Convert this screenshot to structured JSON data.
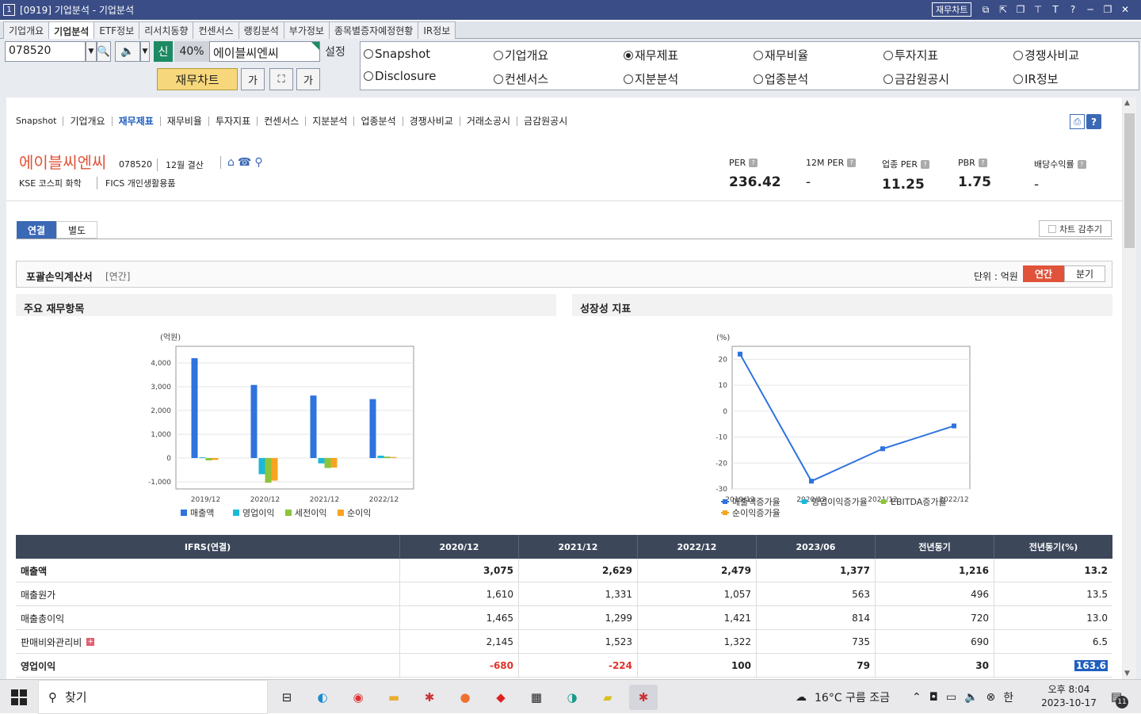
{
  "window": {
    "num": "1",
    "title": "[0919] 기업분석 - 기업분석",
    "fin_chart_btn": "재무차트",
    "icons": [
      "copy-icon",
      "pin-icon",
      "restore-icon",
      "pin2-icon",
      "font-icon",
      "help-icon",
      "minimize-icon",
      "maximize-icon",
      "close-icon"
    ]
  },
  "top_tabs": [
    "기업개요",
    "기업분석",
    "ETF정보",
    "리서치동향",
    "컨센서스",
    "랭킹분석",
    "부가정보",
    "종목별증자예정현황",
    "IR정보"
  ],
  "toolbar": {
    "code": "078520",
    "new_label": "신",
    "percent": "40%",
    "name": "에이블씨엔씨",
    "settings": "설정",
    "fin_chart": "재무차트"
  },
  "radios": [
    {
      "label": "Snapshot",
      "on": false
    },
    {
      "label": "기업개요",
      "on": false
    },
    {
      "label": "재무제표",
      "on": true
    },
    {
      "label": "재무비율",
      "on": false
    },
    {
      "label": "투자지표",
      "on": false
    },
    {
      "label": "경쟁사비교",
      "on": false
    },
    {
      "label": "Disclosure",
      "on": false
    },
    {
      "label": "컨센서스",
      "on": false
    },
    {
      "label": "지분분석",
      "on": false
    },
    {
      "label": "업종분석",
      "on": false
    },
    {
      "label": "금감원공시",
      "on": false
    },
    {
      "label": "IR정보",
      "on": false
    }
  ],
  "subnav": [
    "Snapshot",
    "기업개요",
    "재무제표",
    "재무비율",
    "투자지표",
    "컨센서스",
    "지분분석",
    "업종분석",
    "경쟁사비교",
    "거래소공시",
    "금감원공시"
  ],
  "company": {
    "name": "에이블씨엔씨",
    "code": "078520",
    "settle": "12월 결산",
    "market": "KSE  코스피 화학",
    "fics": "FICS 개인생활용품"
  },
  "metrics": [
    {
      "label": "PER",
      "value": "236.42"
    },
    {
      "label": "12M PER",
      "value": "-"
    },
    {
      "label": "업종 PER",
      "value": "11.25"
    },
    {
      "label": "PBR",
      "value": "1.75"
    },
    {
      "label": "배당수익률",
      "value": "-"
    }
  ],
  "consol_tabs": [
    "연결",
    "별도"
  ],
  "chart_collapse": "차트 감추기",
  "section": {
    "title": "포괄손익계산서",
    "sub": "[연간]",
    "unit": "단위 : 억원",
    "annual": "연간",
    "quarter": "분기"
  },
  "panels": {
    "left": "주요 재무항목",
    "right": "성장성 지표"
  },
  "chart_data": [
    {
      "type": "bar",
      "title": "주요 재무항목",
      "ylabel": "(억원)",
      "categories": [
        "2019/12",
        "2020/12",
        "2021/12",
        "2022/12"
      ],
      "series": [
        {
          "name": "매출액",
          "color": "#2e73de",
          "values": [
            4200,
            3075,
            2629,
            2479
          ]
        },
        {
          "name": "영업이익",
          "color": "#1cb8d8",
          "values": [
            30,
            -680,
            -224,
            100
          ]
        },
        {
          "name": "세전이익",
          "color": "#8cc43c",
          "values": [
            -100,
            -1040,
            -420,
            60
          ]
        },
        {
          "name": "순이익",
          "color": "#f7a420",
          "values": [
            -80,
            -950,
            -400,
            40
          ]
        }
      ],
      "ylim": [
        -1300,
        4700
      ],
      "yticks": [
        4000,
        3000,
        2000,
        1000,
        0,
        -1000
      ],
      "ytick_labels": [
        "4,000",
        "3,000",
        "2,000",
        "1,000",
        "0",
        "-1,000"
      ],
      "grid": true,
      "legend": "bottom"
    },
    {
      "type": "line",
      "title": "성장성 지표",
      "ylabel": "(%)",
      "categories": [
        "2019/12",
        "2020/12",
        "2021/12",
        "2022/12"
      ],
      "series": [
        {
          "name": "매출액증가율",
          "color": "#2e73de",
          "values": [
            22,
            -27,
            -14.5,
            -5.7
          ]
        },
        {
          "name": "영업이익증가율",
          "color": "#1cb8d8",
          "values": []
        },
        {
          "name": "EBITDA증가율",
          "color": "#8cc43c",
          "values": []
        },
        {
          "name": "순이익증가율",
          "color": "#f7a420",
          "values": []
        }
      ],
      "ylim": [
        -30,
        25
      ],
      "yticks": [
        20,
        10,
        0,
        -10,
        -20,
        -30
      ],
      "ytick_labels": [
        "20",
        "10",
        "0",
        "-10",
        "-20",
        "-30"
      ],
      "grid": true,
      "legend": "bottom"
    }
  ],
  "table": {
    "headers": [
      "IFRS(연결)",
      "2020/12",
      "2021/12",
      "2022/12",
      "2023/06",
      "전년동기",
      "전년동기(%)"
    ],
    "rows": [
      {
        "label": "매출액",
        "bold": true,
        "plus": false,
        "cells": [
          "3,075",
          "2,629",
          "2,479",
          "1,377",
          "1,216",
          "13.2"
        ]
      },
      {
        "label": "매출원가",
        "bold": false,
        "plus": false,
        "cells": [
          "1,610",
          "1,331",
          "1,057",
          "563",
          "496",
          "13.5"
        ]
      },
      {
        "label": "매출총이익",
        "bold": false,
        "plus": false,
        "cells": [
          "1,465",
          "1,299",
          "1,421",
          "814",
          "720",
          "13.0"
        ]
      },
      {
        "label": "판매비와관리비",
        "bold": false,
        "plus": true,
        "cells": [
          "2,145",
          "1,523",
          "1,322",
          "735",
          "690",
          "6.5"
        ]
      },
      {
        "label": "영업이익",
        "bold": true,
        "plus": false,
        "cells": [
          "-680",
          "-224",
          "100",
          "79",
          "30",
          "163.6"
        ]
      }
    ]
  },
  "taskbar": {
    "search": "찾기",
    "weather": "16°C  구름 조금",
    "ime": "한",
    "time": "오후 8:04",
    "date": "2023-10-17",
    "notif_count": "11"
  }
}
